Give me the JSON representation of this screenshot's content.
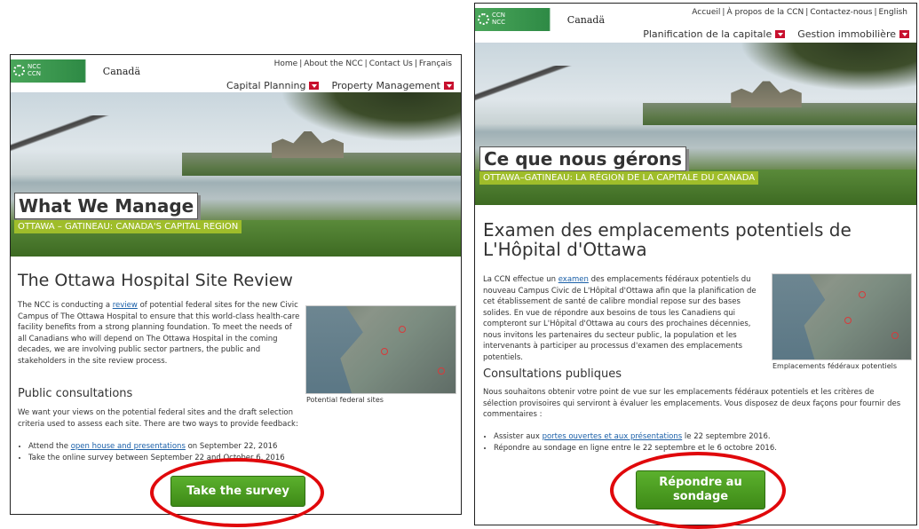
{
  "english": {
    "logo": {
      "ncc_line1": "NCC",
      "ncc_line2": "CCN",
      "canada": "Canadä"
    },
    "toplinks": [
      "Home",
      "About the NCC",
      "Contact Us",
      "Français"
    ],
    "nav": [
      {
        "label": "Capital Planning"
      },
      {
        "label": "Property Management"
      }
    ],
    "hero_title": "What We Manage",
    "hero_subtitle": "OTTAWA – GATINEAU: CANADA'S CAPITAL REGION",
    "page_title": "The Ottawa Hospital Site Review",
    "intro_before_link": "The NCC is conducting a ",
    "intro_link": "review",
    "intro_after_link": " of potential federal sites for the new Civic Campus of The Ottawa Hospital to ensure that this world-class health-care facility benefits from a strong planning foundation. To meet the needs of all Canadians who will depend on The Ottawa Hospital in the coming decades, we are involving public sector partners, the public and stakeholders in the site review process.",
    "map_caption": "Potential federal sites",
    "consultations_heading": "Public consultations",
    "consultations_text": "We want your views on the potential federal sites and the draft selection criteria used to assess each site. There are two ways to provide feedback:",
    "bullet1_before": "Attend the ",
    "bullet1_link": "open house and presentations",
    "bullet1_after": " on September 22, 2016",
    "bullet2": "Take the online survey between September 22 and October 6, 2016",
    "cta": "Take the survey"
  },
  "french": {
    "logo": {
      "ncc_line1": "CCN",
      "ncc_line2": "NCC",
      "canada": "Canadä"
    },
    "toplinks": [
      "Accueil",
      "À propos de la CCN",
      "Contactez-nous",
      "English"
    ],
    "nav": [
      {
        "label": "Planification de la capitale"
      },
      {
        "label": "Gestion immobilière"
      }
    ],
    "hero_title": "Ce que nous gérons",
    "hero_subtitle": "OTTAWA–GATINEAU: LA RÉGION DE LA CAPITALE DU CANADA",
    "page_title": "Examen des emplacements potentiels de L'Hôpital d'Ottawa",
    "intro_before_link": "La CCN effectue un ",
    "intro_link": "examen",
    "intro_after_link": " des emplacements fédéraux potentiels du nouveau Campus Civic de L'Hôpital d'Ottawa afin que la planification de cet établissement de santé de calibre mondial repose sur des bases solides. En vue de répondre aux besoins de tous les Canadiens qui compteront sur L'Hôpital d'Ottawa au cours des prochaines décennies, nous invitons les partenaires du secteur public, la population et les intervenants à participer au processus d'examen des emplacements potentiels.",
    "map_caption": "Emplacements fédéraux potentiels",
    "consultations_heading": "Consultations publiques",
    "consultations_text": "Nous souhaitons obtenir votre point de vue sur les emplacements fédéraux potentiels et les critères de sélection provisoires qui serviront à évaluer les emplacements. Vous disposez de deux façons pour fournir des commentaires :",
    "bullet1_before": "Assister aux ",
    "bullet1_link": "portes ouvertes et aux présentations",
    "bullet1_after": " le 22 septembre 2016.",
    "bullet2": "Répondre au sondage en ligne entre le 22 septembre et le 6 octobre 2016.",
    "cta": "Répondre au sondage"
  },
  "colors": {
    "accent_green": "#9fbd2a",
    "cta_green": "#4a9a22",
    "nav_red": "#c8102e",
    "highlight_ring": "#e0080b",
    "link": "#1a5fa8"
  }
}
